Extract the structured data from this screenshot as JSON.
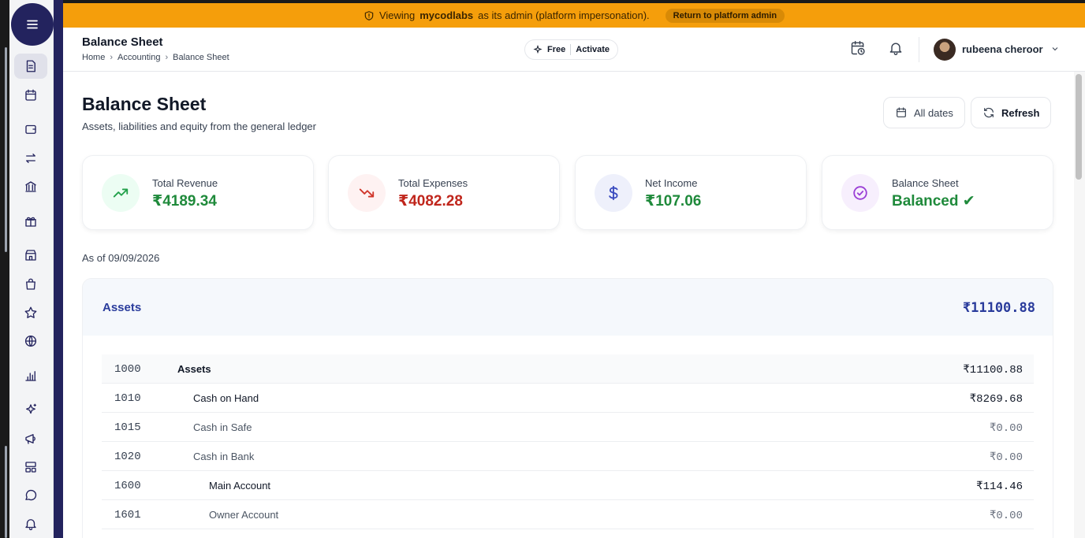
{
  "banner": {
    "prefix": "Viewing",
    "org": "mycodlabs",
    "suffix": "as its admin (platform impersonation).",
    "return_label": "Return to platform admin"
  },
  "header": {
    "title": "Balance Sheet",
    "breadcrumb": [
      "Home",
      "Accounting",
      "Balance Sheet"
    ],
    "plan": "Free",
    "activate": "Activate",
    "user_name": "rubeena cheroor"
  },
  "page": {
    "title": "Balance Sheet",
    "subtitle": "Assets, liabilities and equity from the general ledger",
    "dates_label": "All dates",
    "refresh_label": "Refresh",
    "as_of": "As of 09/09/2026"
  },
  "cards": [
    {
      "label": "Total Revenue",
      "value": "₹4189.34",
      "color": "#1f8a3b",
      "bg": "#ecfdf3",
      "icon": "trend-up-icon"
    },
    {
      "label": "Total Expenses",
      "value": "₹4082.28",
      "color": "#c0261c",
      "bg": "#fef2f2",
      "icon": "trend-down-icon"
    },
    {
      "label": "Net Income",
      "value": "₹107.06",
      "color": "#1f8a3b",
      "bg": "#eef0fb",
      "icon": "dollar-icon"
    },
    {
      "label": "Balance Sheet",
      "value": "Balanced ✔",
      "color": "#1f8a3b",
      "bg": "#f7effd",
      "icon": "check-circle-icon"
    }
  ],
  "assets": {
    "title": "Assets",
    "total": "₹11100.88",
    "rows": [
      {
        "code": "1000",
        "name": "Assets",
        "amount": "₹11100.88",
        "level": 0,
        "zero": false
      },
      {
        "code": "1010",
        "name": "Cash on Hand",
        "amount": "₹8269.68",
        "level": 1,
        "zero": false
      },
      {
        "code": "1015",
        "name": "Cash in Safe",
        "amount": "₹0.00",
        "level": 1,
        "zero": true
      },
      {
        "code": "1020",
        "name": "Cash in Bank",
        "amount": "₹0.00",
        "level": 1,
        "zero": true
      },
      {
        "code": "1600",
        "name": "Main Account",
        "amount": "₹114.46",
        "level": 2,
        "zero": false
      },
      {
        "code": "1601",
        "name": "Owner Account",
        "amount": "₹0.00",
        "level": 2,
        "zero": true
      }
    ]
  }
}
